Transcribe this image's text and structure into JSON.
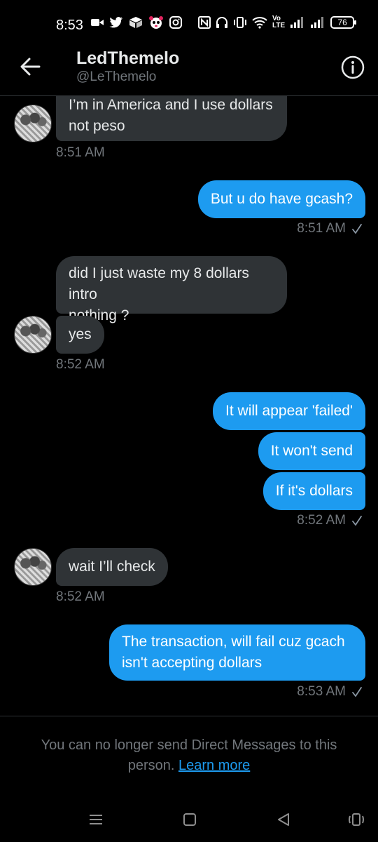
{
  "status_bar": {
    "time": "8:53",
    "battery": "76",
    "network_label_top": "Vo",
    "network_label_bottom": "LTE"
  },
  "header": {
    "name": "LedThemelo",
    "handle": "@LeThemelo"
  },
  "messages": [
    {
      "id": "m1",
      "direction": "in",
      "lines": [
        "I’m in America and I use dollars",
        "not peso"
      ]
    },
    {
      "id": "t1",
      "time": "8:51 AM"
    },
    {
      "id": "m2",
      "direction": "out",
      "lines": [
        "But u do have gcash?"
      ]
    },
    {
      "id": "t2",
      "time": "8:51 AM"
    },
    {
      "id": "m3",
      "direction": "in",
      "lines": [
        "did I just waste my 8 dollars intro",
        "nothing ?"
      ]
    },
    {
      "id": "m4",
      "direction": "in",
      "lines": [
        "yes"
      ]
    },
    {
      "id": "t3",
      "time": "8:52 AM"
    },
    {
      "id": "m5",
      "direction": "out",
      "lines": [
        "It will appear 'failed'"
      ]
    },
    {
      "id": "m6",
      "direction": "out",
      "lines": [
        "It won't send"
      ]
    },
    {
      "id": "m7",
      "direction": "out",
      "lines": [
        "If it's dollars"
      ]
    },
    {
      "id": "t4",
      "time": "8:52 AM"
    },
    {
      "id": "m8",
      "direction": "in",
      "lines": [
        "wait I’ll check"
      ]
    },
    {
      "id": "t5",
      "time": "8:52 AM"
    },
    {
      "id": "m9",
      "direction": "out",
      "lines": [
        "The transaction, will fail cuz gcach",
        "isn't accepting dollars"
      ]
    },
    {
      "id": "t6",
      "time": "8:53 AM"
    }
  ],
  "footer": {
    "notice_line1": "You can no longer send Direct Messages to this",
    "notice_line2_prefix": "person.",
    "learn_more": "Learn more"
  },
  "icons": {
    "back": "back-arrow-icon",
    "info": "info-icon",
    "read_receipt": "checkmark-icon",
    "nav_menu": "recent-apps-icon",
    "nav_home": "home-icon",
    "nav_back": "back-triangle-icon",
    "nav_assist": "assistant-icon"
  },
  "colors": {
    "background": "#000000",
    "outgoing_bubble": "#1d9bf0",
    "incoming_bubble": "#2f3336",
    "secondary_text": "#71767b",
    "link": "#1d9bf0"
  }
}
